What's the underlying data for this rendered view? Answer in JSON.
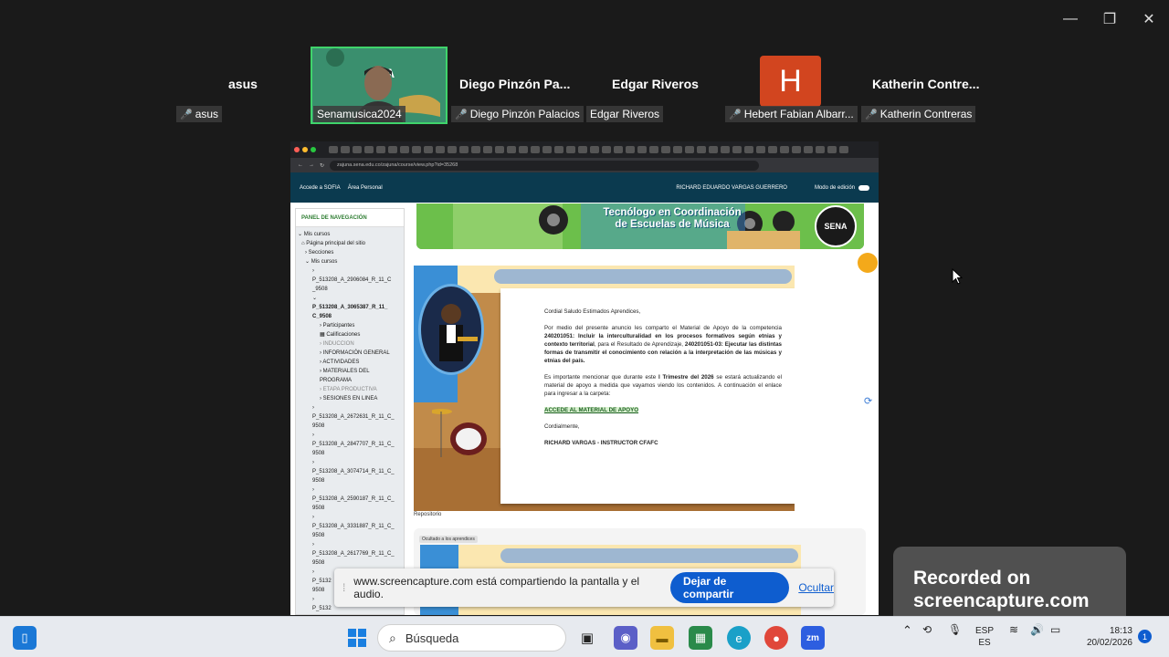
{
  "window_controls": {
    "minimize": "—",
    "restore": "❐",
    "close": "✕"
  },
  "participants": [
    {
      "name": "asus",
      "tag": "asus"
    },
    {
      "tag": "Senamusica2024"
    },
    {
      "name": "Diego  Pinzón  Pa...",
      "tag": "Diego Pinzón Palacios"
    },
    {
      "name": "Edgar Riveros",
      "tag": "Edgar Riveros"
    },
    {
      "avatar_letter": "H",
      "tag": "Hebert Fabian Albarr..."
    },
    {
      "name": "Katherin  Contre...",
      "tag": "Katherin Contreras"
    }
  ],
  "shared_screen": {
    "url": "zajuna.sena.edu.co/zajuna/course/view.php?id=35268",
    "moodle_nav": {
      "link1": "Accede a SOFIA",
      "link2": "Área Personal",
      "user": "RICHARD EDUARDO VARGAS GUERRERO",
      "edit_mode": "Modo de edición"
    },
    "nav_panel": {
      "heading": "PANEL DE NAVEGACIÓN",
      "items": [
        {
          "label": "⌄ Mis cursos",
          "indent": 2
        },
        {
          "label": "⌂ Página principal del sitio",
          "indent": 6
        },
        {
          "label": "› Secciones",
          "indent": 10
        },
        {
          "label": "⌄ Mis cursos",
          "indent": 10
        },
        {
          "label": "›",
          "indent": 18
        },
        {
          "label": "P_513208_A_2906084_R_11_C",
          "indent": 18
        },
        {
          "label": "_9508",
          "indent": 18
        },
        {
          "label": "⌄",
          "indent": 18
        },
        {
          "label": "P_513208_A_3065387_R_11_",
          "indent": 18,
          "bold": true
        },
        {
          "label": "C_9508",
          "indent": 18,
          "bold": true
        },
        {
          "label": "› Participantes",
          "indent": 26
        },
        {
          "label": "▦ Calificaciones",
          "indent": 26
        },
        {
          "label": "› INDUCCION",
          "indent": 26,
          "grey": true
        },
        {
          "label": "› INFORMACIÓN GENERAL",
          "indent": 26
        },
        {
          "label": "› ACTIVIDADES",
          "indent": 26
        },
        {
          "label": "› MATERIALES DEL",
          "indent": 26
        },
        {
          "label": "PROGRAMA",
          "indent": 26
        },
        {
          "label": "› ETAPA PRODUCTIVA",
          "indent": 26,
          "grey": true
        },
        {
          "label": "› SESIONES EN LINEA",
          "indent": 26
        },
        {
          "label": "›",
          "indent": 18
        },
        {
          "label": "P_513208_A_2672631_R_11_C_",
          "indent": 18
        },
        {
          "label": "9508",
          "indent": 18
        },
        {
          "label": "›",
          "indent": 18
        },
        {
          "label": "P_513208_A_2847707_R_11_C_",
          "indent": 18
        },
        {
          "label": "9508",
          "indent": 18
        },
        {
          "label": "›",
          "indent": 18
        },
        {
          "label": "P_513208_A_3074714_R_11_C_",
          "indent": 18
        },
        {
          "label": "9508",
          "indent": 18
        },
        {
          "label": "›",
          "indent": 18
        },
        {
          "label": "P_513208_A_2590187_R_11_C_",
          "indent": 18
        },
        {
          "label": "9508",
          "indent": 18
        },
        {
          "label": "›",
          "indent": 18
        },
        {
          "label": "P_513208_A_3331887_R_11_C_",
          "indent": 18
        },
        {
          "label": "9508",
          "indent": 18
        },
        {
          "label": "›",
          "indent": 18
        },
        {
          "label": "P_513208_A_2617769_R_11_C_",
          "indent": 18
        },
        {
          "label": "9508",
          "indent": 18
        },
        {
          "label": "›",
          "indent": 18
        },
        {
          "label": "P_5132",
          "indent": 18
        },
        {
          "label": "9508",
          "indent": 18
        },
        {
          "label": "›",
          "indent": 18
        },
        {
          "label": "P_5132",
          "indent": 18
        }
      ]
    },
    "banner": {
      "line1": "Tecnólogo en Coordinación",
      "line2": "de Escuelas de Música",
      "logo": "SENA"
    },
    "announcement": {
      "greeting": "Cordial Saludo Estimados Aprendices,",
      "p1_a": "Por medio del presente anuncio les comparto el Material de Apoyo de la competencia ",
      "p1_b": "240201051: Incluir la interculturalidad en los procesos formativos según etnias y contexto territorial",
      "p1_c": ", para el Resultado de Aprendizaje, ",
      "p1_d": "240201051-03: Ejecutar las distintas formas de transmitir el conocimiento con relación a la interpretación de las músicas y etnias del país.",
      "p2_a": "Es importante mencionar que durante este ",
      "p2_b": "I Trimestre del 2026",
      "p2_c": " se estará actualizando el material de apoyo a medida que vayamos viendo los contenidos. A continuación el enlace para ingresar a la carpeta:",
      "link": "ACCEDE AL MATERIAL DE APOYO",
      "closing": "Cordialmente,",
      "signature": "RICHARD VARGAS - INSTRUCTOR CFAFC"
    },
    "repositorio": "Repositorio",
    "second_card_chip": "Ocultado a los aprendices"
  },
  "share_notice": {
    "text": "www.screencapture.com está compartiendo la pantalla y el audio.",
    "stop": "Dejar de compartir",
    "hide": "Ocultar"
  },
  "watermark": {
    "line1": "Recorded on",
    "line2": "screencapture.com"
  },
  "taskbar": {
    "search_placeholder": "Búsqueda",
    "lang_top": "ESP",
    "lang_bottom": "ES",
    "time": "18:13",
    "date": "20/02/2026",
    "notifications": "1"
  },
  "colors": {
    "accent": "#0e5dcf",
    "moodle_bar": "#0b3a4f",
    "active_tile": "#3fd46b",
    "h_avatar": "#d2451f"
  }
}
